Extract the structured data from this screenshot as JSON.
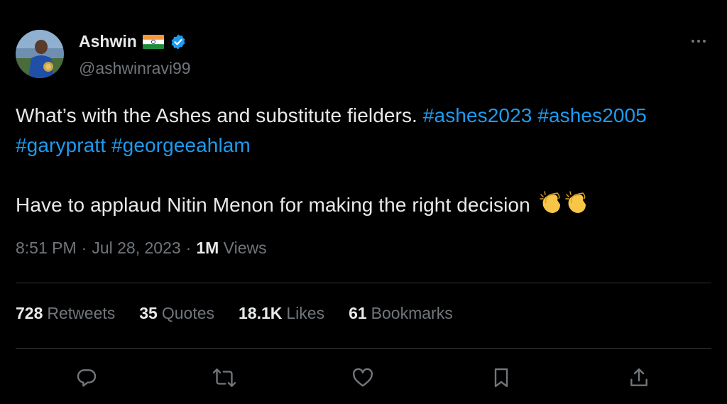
{
  "author": {
    "display_name": "Ashwin",
    "handle": "@ashwinravi99",
    "flag_icon": "india-flag-icon",
    "verified_icon": "verified-badge-icon",
    "verified_color": "#1d9bf0"
  },
  "tweet": {
    "line1_text": "What’s with the Ashes and substitute fielders.",
    "hashtags_line1": [
      "#ashes2023",
      "#ashes2005"
    ],
    "hashtags_line2": [
      "#garypratt",
      "#georgeeahlam"
    ],
    "line3_text": "Have to applaud Nitin Menon for making the right decision",
    "emoji": "clapping-hands-icon"
  },
  "meta": {
    "time": "8:51 PM",
    "separator": "·",
    "date": "Jul 28, 2023",
    "views_count": "1M",
    "views_label": "Views"
  },
  "stats": [
    {
      "count": "728",
      "label": "Retweets"
    },
    {
      "count": "35",
      "label": "Quotes"
    },
    {
      "count": "18.1K",
      "label": "Likes"
    },
    {
      "count": "61",
      "label": "Bookmarks"
    }
  ],
  "actions": [
    "reply-icon",
    "retweet-icon",
    "like-icon",
    "bookmark-icon",
    "share-icon"
  ],
  "colors": {
    "background": "#000000",
    "text": "#e7e9ea",
    "secondary": "#71767b",
    "link": "#1d9bf0",
    "divider": "#2f3336"
  }
}
